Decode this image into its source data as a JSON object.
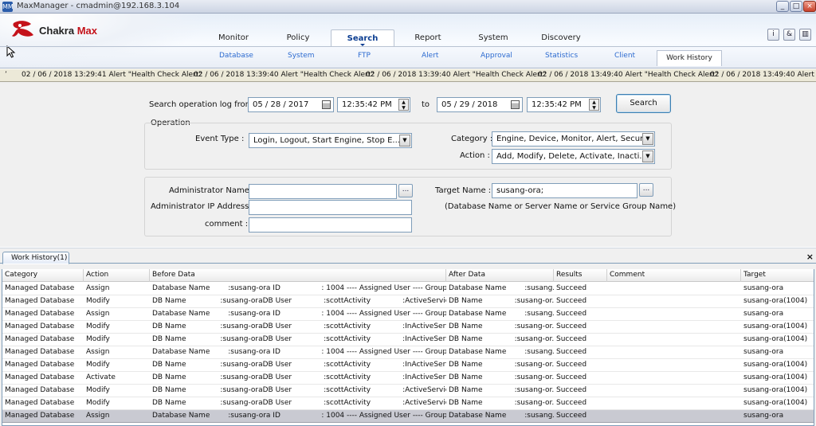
{
  "window": {
    "title": "MaxManager - cmadmin@192.168.3.104",
    "min_label": "_",
    "max_label": "□",
    "close_label": "×"
  },
  "brand": {
    "name_part1": "Chakra",
    "name_part2": "Max",
    "accent": "#c4121a"
  },
  "nav": {
    "tabs": [
      {
        "label": "Monitor"
      },
      {
        "label": "Policy"
      },
      {
        "label": "Search",
        "active": true
      },
      {
        "label": "Report"
      },
      {
        "label": "System"
      },
      {
        "label": "Discovery"
      }
    ],
    "subtabs": [
      {
        "label": "Database"
      },
      {
        "label": "System"
      },
      {
        "label": "FTP"
      },
      {
        "label": "Alert"
      },
      {
        "label": "Approval"
      },
      {
        "label": "Statistics"
      },
      {
        "label": "Client"
      },
      {
        "label": "Work History",
        "active": true
      }
    ],
    "tools": [
      {
        "icon": "info-icon",
        "glyph": "i"
      },
      {
        "icon": "user-icon",
        "glyph": "&"
      },
      {
        "icon": "layout-icon",
        "glyph": "▥"
      }
    ]
  },
  "ticker": {
    "prefix": "ʼ",
    "alerts": [
      "02 / 06 / 2018 13:29:41 Alert \"Health Check Alert\"",
      "02 / 06 / 2018 13:39:40 Alert \"Health Check Alert\"",
      "02 / 06 / 2018 13:39:40 Alert \"Health Check Alert\"",
      "02 / 06 / 2018 13:49:40 Alert \"Health Check Alert\"",
      "02 / 06 / 2018 13:49:40 Alert \"H"
    ]
  },
  "search": {
    "from_label": "Search operation log from",
    "from_date": "05 / 28 / 2017",
    "from_time": "12:35:42 PM",
    "to_label": "to",
    "to_date": "05 / 29 / 2018",
    "to_time": "12:35:42 PM",
    "search_button": "Search",
    "operation_label": "Operation",
    "event_type_label": "Event Type :",
    "event_type_value": "Login, Logout, Start Engine, Stop E...",
    "category_label": "Category :",
    "category_value": "Engine, Device, Monitor, Alert, Secur...",
    "action_label": "Action :",
    "action_value": "Add, Modify, Delete, Activate, Inacti...",
    "admin_name_label": "Administrator Name :",
    "admin_name_value": "",
    "admin_ip_label": "Administrator IP Address :",
    "admin_ip_value": "",
    "comment_label": "comment :",
    "comment_value": "",
    "target_name_label": "Target Name :",
    "target_name_value": "susang-ora;",
    "target_hint": "(Database Name or Server Name or Service Group Name)",
    "browse_label": "..."
  },
  "results": {
    "tab_label": "Work History(1)",
    "close_label": "×",
    "columns": [
      "Category",
      "Action",
      "Before Data",
      "After Data",
      "Results",
      "Comment",
      "Target"
    ],
    "rows": [
      {
        "category": "Managed Database",
        "action": "Assign",
        "before": "Database Name        :susang-ora ID                  : 1004 ---- Assigned User ---- Group        ...",
        "after": "Database Name        :susang...",
        "result": "Succeed",
        "comment": "",
        "target": "susang-ora"
      },
      {
        "category": "Managed Database",
        "action": "Modify",
        "before": "DB Name               :susang-oraDB User              :scottActivity              :ActiveService Na...",
        "after": "DB Name              :susang-or...",
        "result": "Succeed",
        "comment": "",
        "target": "susang-ora(1004)"
      },
      {
        "category": "Managed Database",
        "action": "Assign",
        "before": "Database Name        :susang-ora ID                  : 1004 ---- Assigned User ---- Group        ...",
        "after": "Database Name        :susang...",
        "result": "Succeed",
        "comment": "",
        "target": "susang-ora"
      },
      {
        "category": "Managed Database",
        "action": "Modify",
        "before": "DB Name               :susang-oraDB User              :scottActivity              :InActiveService N...",
        "after": "DB Name              :susang-or...",
        "result": "Succeed",
        "comment": "",
        "target": "susang-ora(1004)"
      },
      {
        "category": "Managed Database",
        "action": "Modify",
        "before": "DB Name               :susang-oraDB User              :scottActivity              :InActiveService N...",
        "after": "DB Name              :susang-or...",
        "result": "Succeed",
        "comment": "",
        "target": "susang-ora(1004)"
      },
      {
        "category": "Managed Database",
        "action": "Assign",
        "before": "Database Name        :susang-ora ID                  : 1004 ---- Assigned User ---- Group        ...",
        "after": "Database Name        :susang...",
        "result": "Succeed",
        "comment": "",
        "target": "susang-ora"
      },
      {
        "category": "Managed Database",
        "action": "Modify",
        "before": "DB Name               :susang-oraDB User              :scottActivity              :InActiveService N...",
        "after": "DB Name              :susang-or...",
        "result": "Succeed",
        "comment": "",
        "target": "susang-ora(1004)"
      },
      {
        "category": "Managed Database",
        "action": "Activate",
        "before": "DB Name               :susang-oraDB User              :scottActivity              :InActiveService N...",
        "after": "DB Name              :susang-or...",
        "result": "Succeed",
        "comment": "",
        "target": "susang-ora(1004)"
      },
      {
        "category": "Managed Database",
        "action": "Modify",
        "before": "DB Name               :susang-oraDB User              :scottActivity              :ActiveService Na...",
        "after": "DB Name              :susang-or...",
        "result": "Succeed",
        "comment": "",
        "target": "susang-ora(1004)"
      },
      {
        "category": "Managed Database",
        "action": "Modify",
        "before": "DB Name               :susang-oraDB User              :scottActivity              :ActiveService Na...",
        "after": "DB Name              :susang-or...",
        "result": "Succeed",
        "comment": "",
        "target": "susang-ora(1004)"
      },
      {
        "category": "Managed Database",
        "action": "Assign",
        "before": "Database Name        :susang-ora ID                  : 1004 ---- Assigned User ---- Group        ...",
        "after": "Database Name        :susang...",
        "result": "Succeed",
        "comment": "",
        "target": "susang-ora",
        "selected": true
      }
    ]
  }
}
